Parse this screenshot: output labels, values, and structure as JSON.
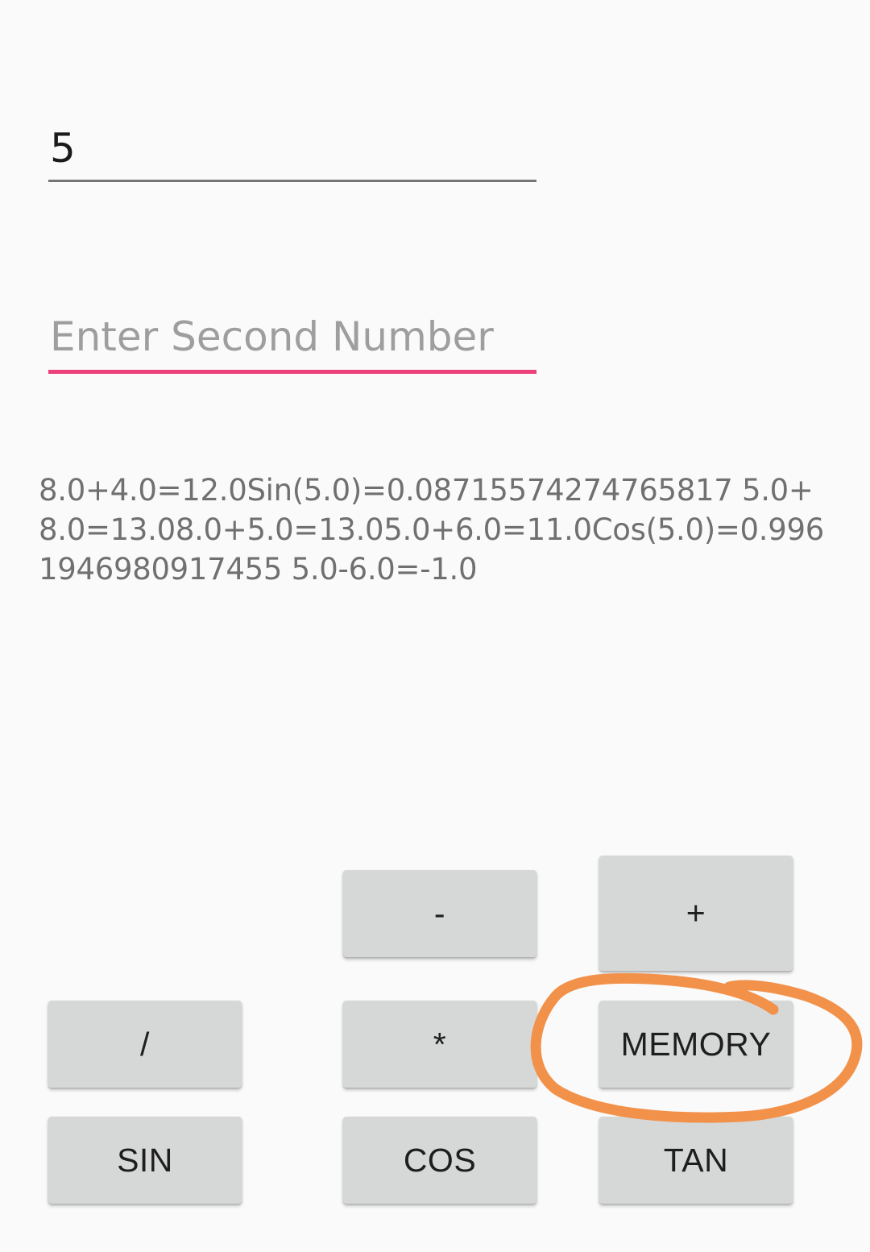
{
  "inputs": {
    "first_value": "5",
    "second_placeholder": "Enter Second Number",
    "second_value": ""
  },
  "result_text": "8.0+4.0=12.0Sin(5.0)=0.08715574274765817 5.0+8.0=13.08.0+5.0=13.05.0+6.0=11.0Cos(5.0)=0.9961946980917455 5.0-6.0=-1.0",
  "buttons": {
    "minus": "-",
    "plus": "+",
    "divide": "/",
    "multiply": "*",
    "memory": "MEMORY",
    "sin": "SIN",
    "cos": "COS",
    "tan": "TAN"
  },
  "colors": {
    "accent": "#ec407a",
    "button_bg": "#d6d7d7",
    "annotation": "#f2914a"
  }
}
